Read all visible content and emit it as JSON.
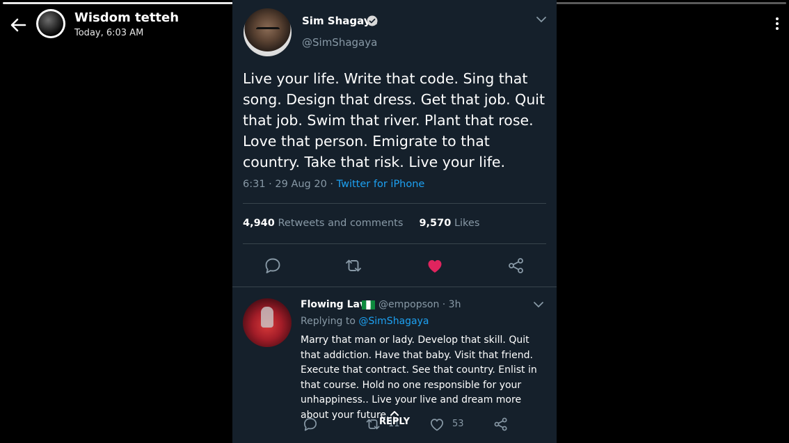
{
  "status_header": {
    "name": "Wisdom tetteh",
    "time": "Today, 6:03 AM",
    "back_icon": "arrow-left-icon",
    "more_icon": "more-vertical-icon"
  },
  "tweet": {
    "author": "Sim Shagaya",
    "handle": "@SimShagaya",
    "text": "Live your life. Write that code. Sing that song. Design that dress. Get that job. Quit that job. Swim that river. Plant that rose. Love that person. Emigrate to that country. Take that risk. Live your life.",
    "time": "6:31 · 29 Aug 20 · ",
    "source": "Twitter for iPhone",
    "retweets_count": "4,940",
    "retweets_label": "Retweets and comments",
    "likes_count": "9,570",
    "likes_label": "Likes"
  },
  "reply": {
    "name": "Flowing Lava",
    "handle": "@empopson · 3h",
    "replying_prefix": "Replying to ",
    "replying_to": "@SimShagaya",
    "text": "Marry that man or lady. Develop that skill. Quit that addiction. Have that baby. Visit that friend. Execute that contract. See that country. Enlist in that course. Hold no one responsible for your unhappiness.. Live your live and dream more about your future...",
    "retweet_count": "11",
    "like_count": "53"
  },
  "reply_bar": {
    "label": "REPLY"
  },
  "colors": {
    "card_bg": "#15202b",
    "link": "#1da1f2",
    "secondary_text": "#8899a6",
    "like": "#e0245e"
  }
}
